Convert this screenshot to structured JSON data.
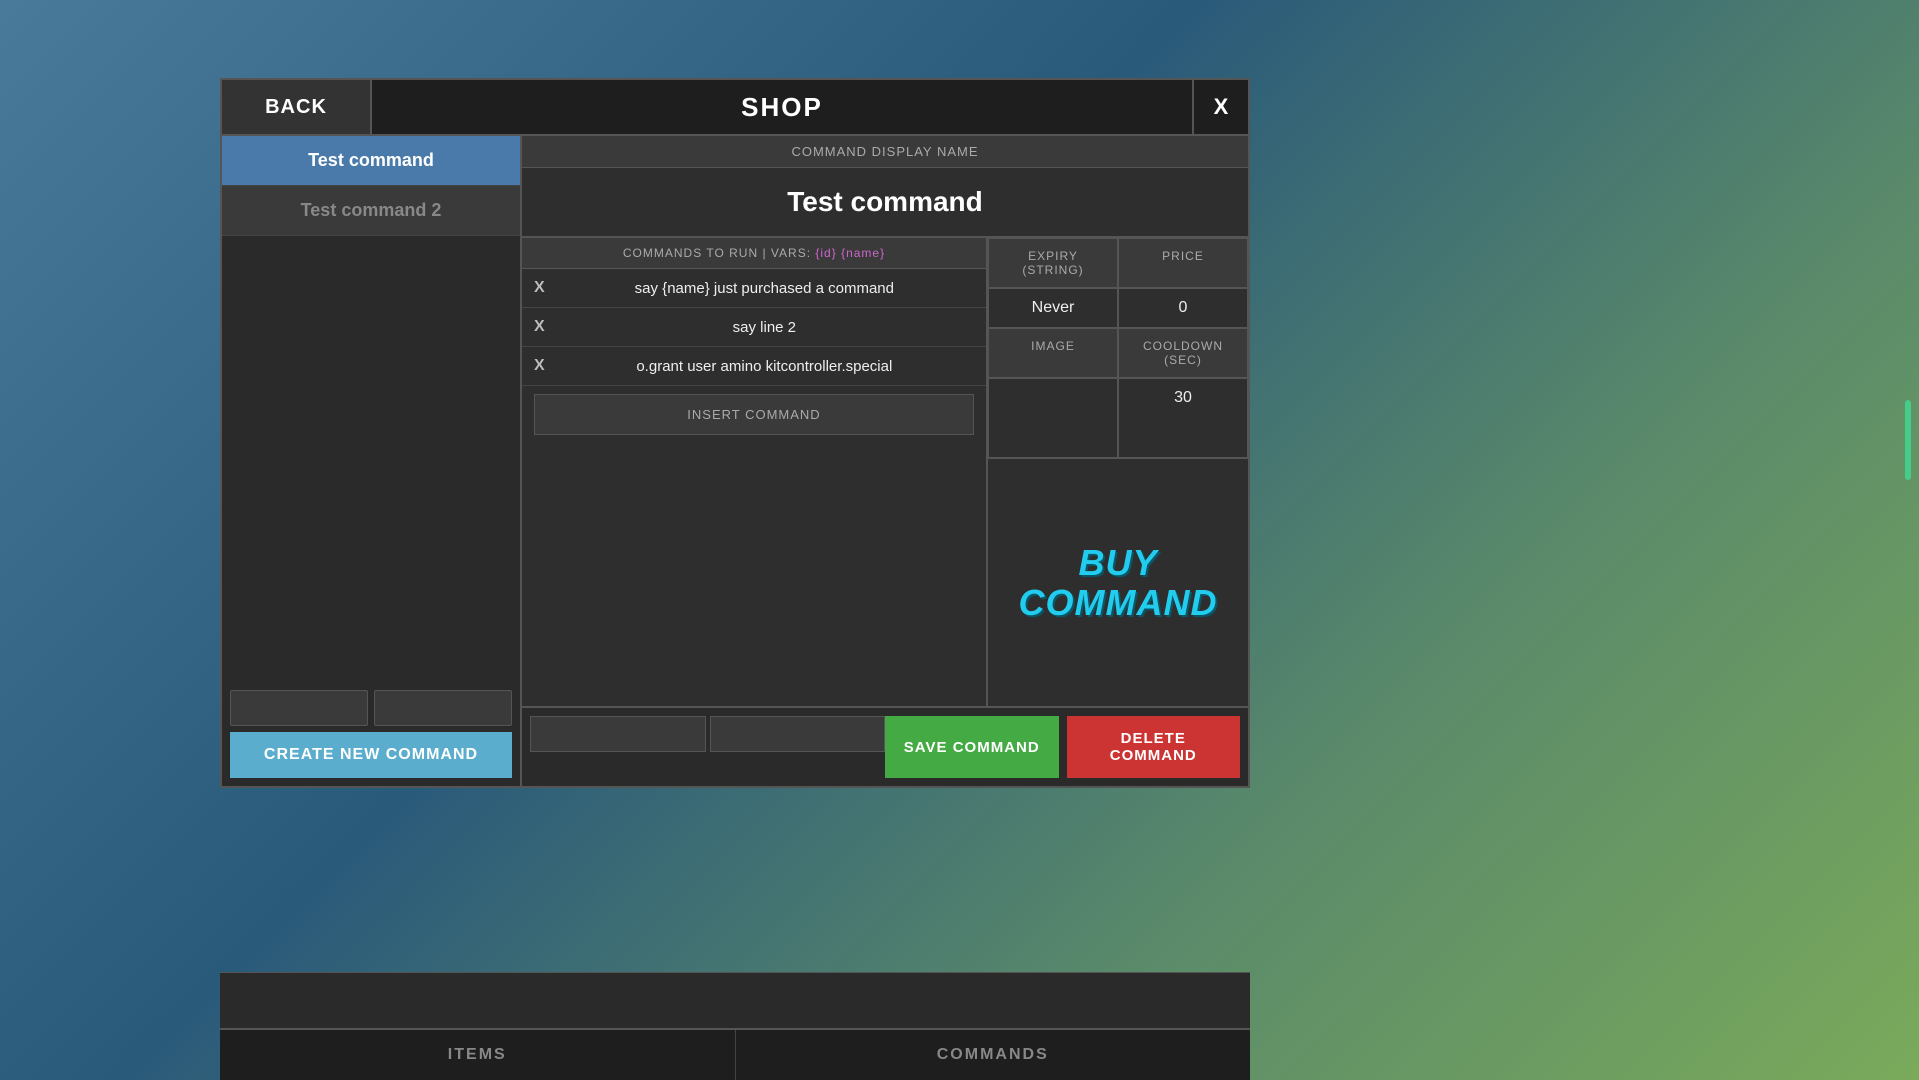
{
  "header": {
    "back_label": "BACK",
    "title": "SHOP",
    "close_label": "X"
  },
  "sidebar": {
    "items": [
      {
        "label": "Test command",
        "active": true
      },
      {
        "label": "Test command 2",
        "active": false
      }
    ],
    "create_new_label": "CREATE NEW COMMAND"
  },
  "command_panel": {
    "display_name_header": "COMMAND DISPLAY NAME",
    "command_name": "Test command",
    "commands_header": "COMMANDS TO RUN | VARS:",
    "vars": "{id} {name}",
    "commands": [
      {
        "text": "say {name} just purchased a command"
      },
      {
        "text": "say line 2"
      },
      {
        "text": "o.grant user amino kitcontroller.special"
      }
    ],
    "insert_command_label": "INSERT COMMAND"
  },
  "right_panel": {
    "expiry_header": "EXPIRY (STRING)",
    "expiry_value": "Never",
    "price_header": "PRICE",
    "price_value": "0",
    "image_header": "IMAGE",
    "cooldown_header": "COOLDOWN (SEC)",
    "cooldown_value": "30",
    "buy_command_label": "BUY COMMAND"
  },
  "footer": {
    "save_label": "SAVE COMMAND",
    "delete_label": "DELETE COMMAND"
  },
  "bottom_tabs": [
    {
      "label": "ITEMS"
    },
    {
      "label": "COMMANDS"
    }
  ]
}
